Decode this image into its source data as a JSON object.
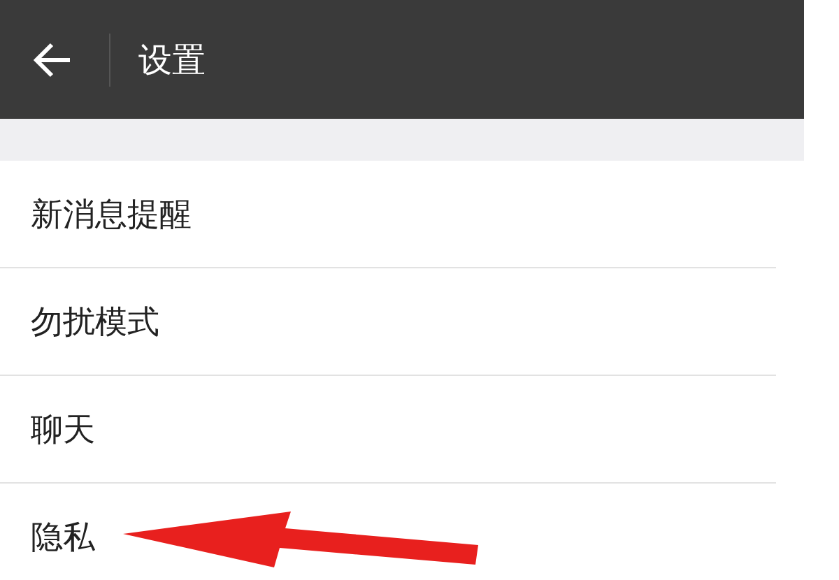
{
  "header": {
    "title": "设置"
  },
  "items": [
    {
      "label": "新消息提醒"
    },
    {
      "label": "勿扰模式"
    },
    {
      "label": "聊天"
    },
    {
      "label": "隐私",
      "annotated": true
    }
  ]
}
